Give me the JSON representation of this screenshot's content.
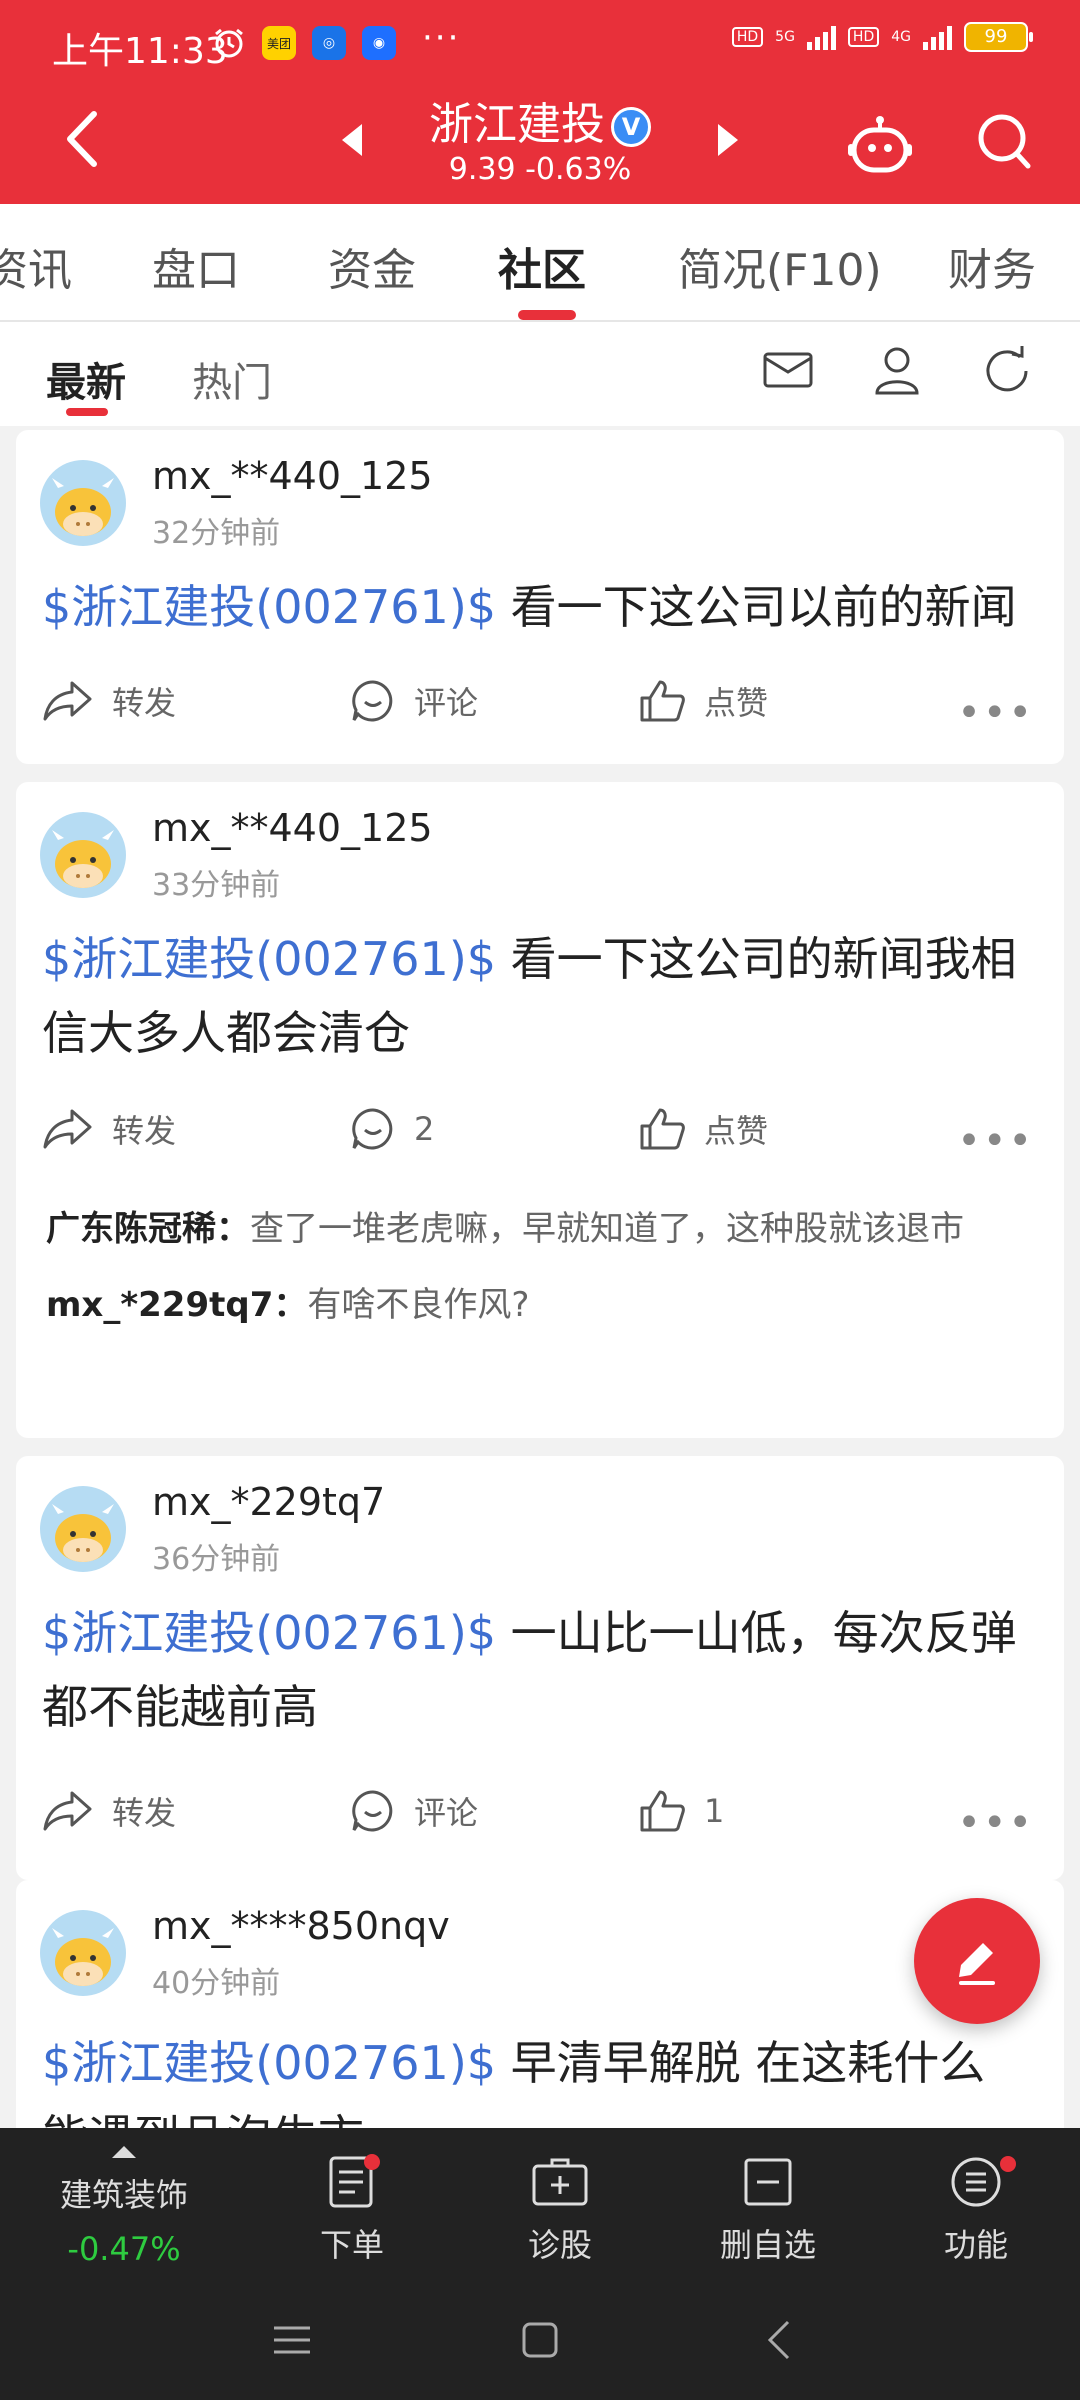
{
  "status_bar": {
    "time": "上午11:33",
    "app_meituan": "美团",
    "network_1": "5G",
    "network_2": "4G",
    "battery": "99"
  },
  "header": {
    "stock_name": "浙江建投",
    "verified_mark": "V",
    "price_line": "9.39  -0.63%"
  },
  "top_tabs": [
    "资讯",
    "盘口",
    "资金",
    "社区",
    "简况(F10)",
    "财务"
  ],
  "sub_tabs": [
    "最新",
    "热门"
  ],
  "posts": [
    {
      "username": "mx_**440_125",
      "time": "32分钟前",
      "tag": "$浙江建投(002761)$",
      "text": " 看一下这公司以前的新闻",
      "share": "转发",
      "comment": "评论",
      "like": "点赞"
    },
    {
      "username": "mx_**440_125",
      "time": "33分钟前",
      "tag": "$浙江建投(002761)$",
      "text": " 看一下这公司的新闻我相信大多人都会清仓",
      "share": "转发",
      "comment": "2",
      "like": "点赞",
      "replies": [
        {
          "user": "广东陈冠稀：",
          "text": "查了一堆老虎嘛，早就知道了，这种股就该退市"
        },
        {
          "user": "mx_*229tq7：",
          "text": "有啥不良作风?"
        }
      ]
    },
    {
      "username": "mx_*229tq7",
      "time": "36分钟前",
      "tag": "$浙江建投(002761)$",
      "text": " 一山比一山低，每次反弹都不能越前高",
      "share": "转发",
      "comment": "评论",
      "like": "1"
    },
    {
      "username": "mx_****850nqv",
      "time": "40分钟前",
      "tag": "$浙江建投(002761)$",
      "text": " 早清早解脱 在这耗什么 能遇到品泡牛市"
    }
  ],
  "bottom_bar": {
    "sector_name": "建筑装饰",
    "sector_change": "-0.47%",
    "items": [
      "下单",
      "诊股",
      "删自选",
      "功能"
    ]
  },
  "colors": {
    "brand_red": "#e8303a",
    "tag_blue": "#3e6fd1",
    "down_green": "#2ecc40"
  }
}
